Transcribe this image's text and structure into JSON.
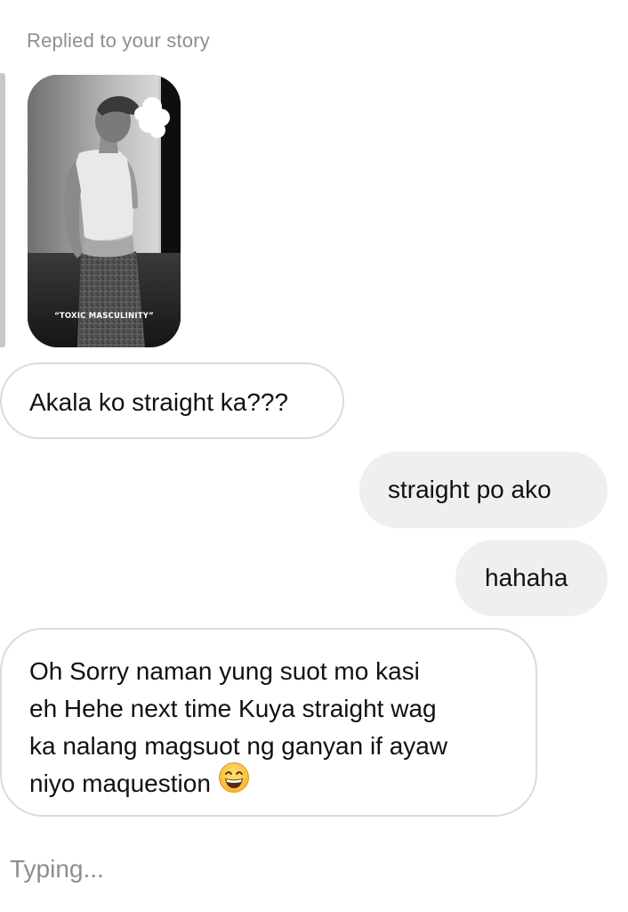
{
  "thread": {
    "replied_label": "Replied to your story",
    "story": {
      "caption": "“TOXIC MASCULINITY”"
    },
    "messages": [
      {
        "from": "them",
        "text": "Akala ko straight ka???"
      },
      {
        "from": "me",
        "text": "straight po ako"
      },
      {
        "from": "me",
        "text": "hahaha"
      },
      {
        "from": "them",
        "lines": [
          "Oh Sorry naman yung suot mo kasi",
          "eh Hehe next time Kuya straight wag",
          "ka nalang magsuot ng ganyan if ayaw",
          "niyo maquestion"
        ],
        "emoji": "grinning-face-icon"
      }
    ],
    "typing_status": "Typing..."
  },
  "colors": {
    "outgoing_bubble": "#efefef",
    "incoming_border": "#dbdbdb",
    "muted_text": "#8e8e8e",
    "reply_bar": "#c7c7c7"
  }
}
